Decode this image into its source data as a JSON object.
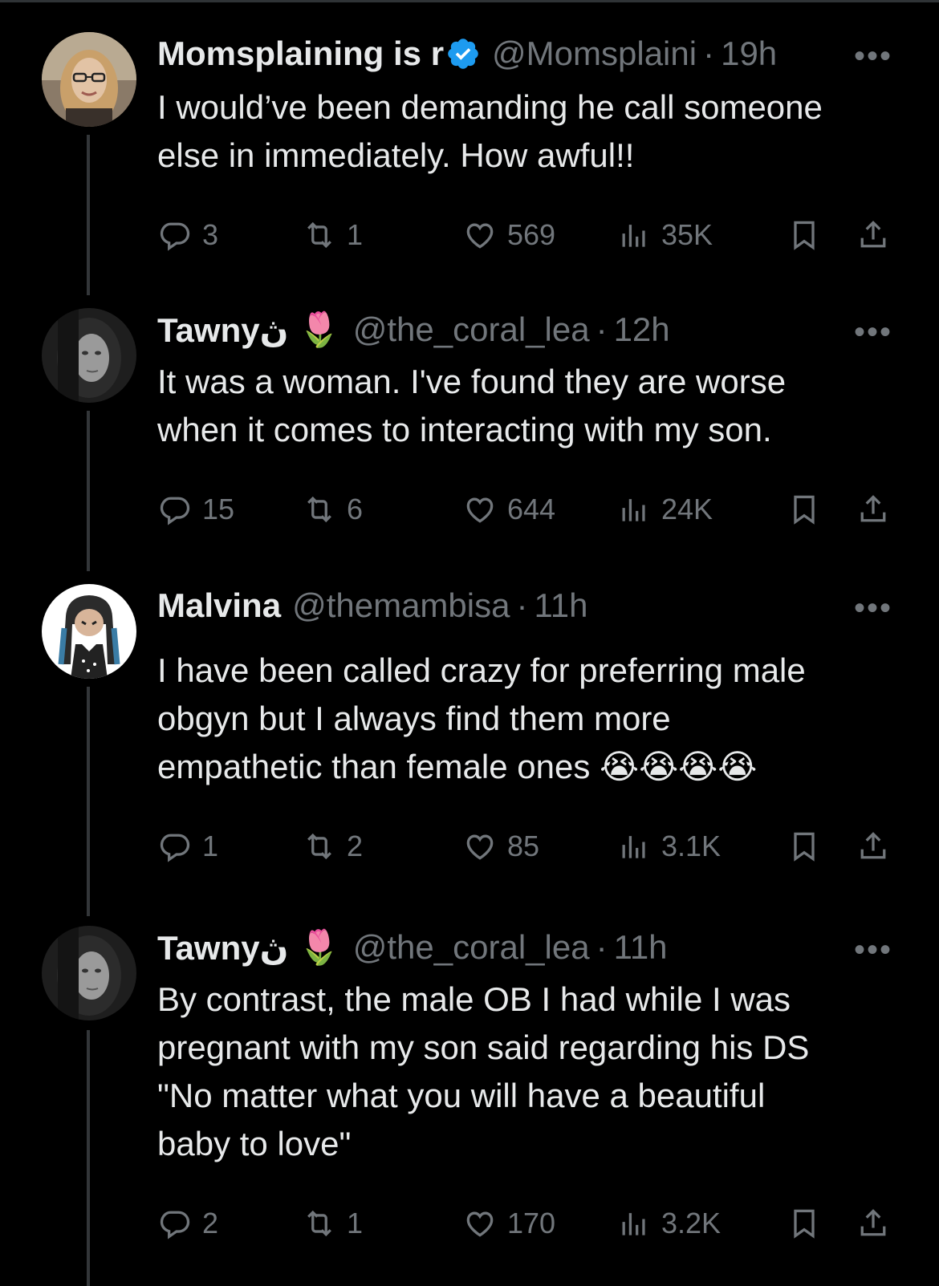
{
  "tweets": [
    {
      "name": "Momsplaining is r",
      "verified": true,
      "handle": "@Momsplaini",
      "time": "19h",
      "text": [
        "I would’ve been demanding he call someone",
        "else in immediately. How awful!!"
      ],
      "replies": "3",
      "reposts": "1",
      "likes": "569",
      "views": "35K"
    },
    {
      "name": "Tawnyڽ",
      "emoji": "🌷",
      "handle": "@the_coral_lea",
      "time": "12h",
      "text": [
        "It was a woman. I've found they are worse",
        "when it comes to interacting with my son."
      ],
      "replies": "15",
      "reposts": "6",
      "likes": "644",
      "views": "24K"
    },
    {
      "name": "Malvina",
      "handle": "@themambisa",
      "time": "11h",
      "text": [
        "I have been called crazy for preferring male",
        "obgyn but I always find them more",
        "empathetic than female ones 😭😭😭😭"
      ],
      "replies": "1",
      "reposts": "2",
      "likes": "85",
      "views": "3.1K"
    },
    {
      "name": "Tawnyڽ",
      "emoji": "🌷",
      "handle": "@the_coral_lea",
      "time": "11h",
      "text": [
        "By contrast, the male OB I had while I was",
        "pregnant with my son said regarding his DS",
        "\"No matter what you will have a beautiful",
        "baby to love\""
      ],
      "replies": "2",
      "reposts": "1",
      "likes": "170",
      "views": "3.2K"
    }
  ],
  "ui": {
    "more": "•••",
    "dot": "·"
  },
  "colors": {
    "background": "#000000",
    "text": "#e7e9ea",
    "muted": "#71767b",
    "verified": "#1d9bf0",
    "thread_line": "#333639"
  }
}
